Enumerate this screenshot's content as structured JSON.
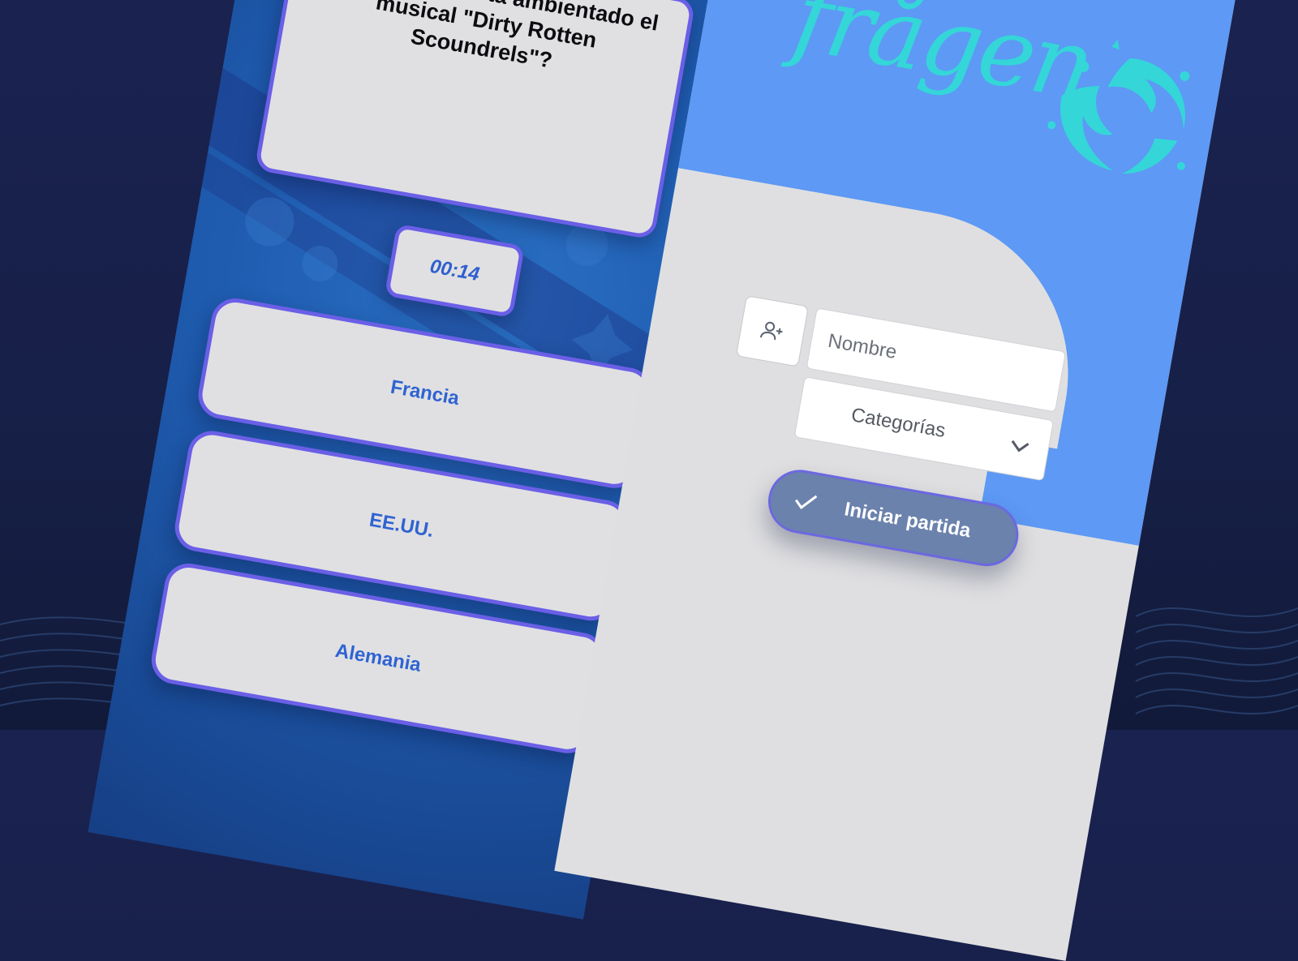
{
  "quiz": {
    "question": "¿En qué país está ambientado el musical \"Dirty Rotten Scoundrels\"?",
    "timer": "00:14",
    "answers": [
      {
        "label": "Francia"
      },
      {
        "label": "EE.UU."
      },
      {
        "label": "Alemania"
      }
    ]
  },
  "start_screen": {
    "logo_text": "frågen",
    "name_placeholder": "Nombre",
    "categories_label": "Categorías",
    "start_button_label": "Iniciar partida"
  },
  "colors": {
    "background": "#1a2250",
    "quiz_bg": "#1f5cb0",
    "card_border": "#6a5fe6",
    "answer_text": "#2f63d2",
    "hero": "#5d99f5",
    "logo": "#34d6d8",
    "start_button": "#6b82ad"
  },
  "icons": {
    "add_user": "add-user-icon",
    "chevron": "chevron-down-icon",
    "check": "check-icon"
  }
}
